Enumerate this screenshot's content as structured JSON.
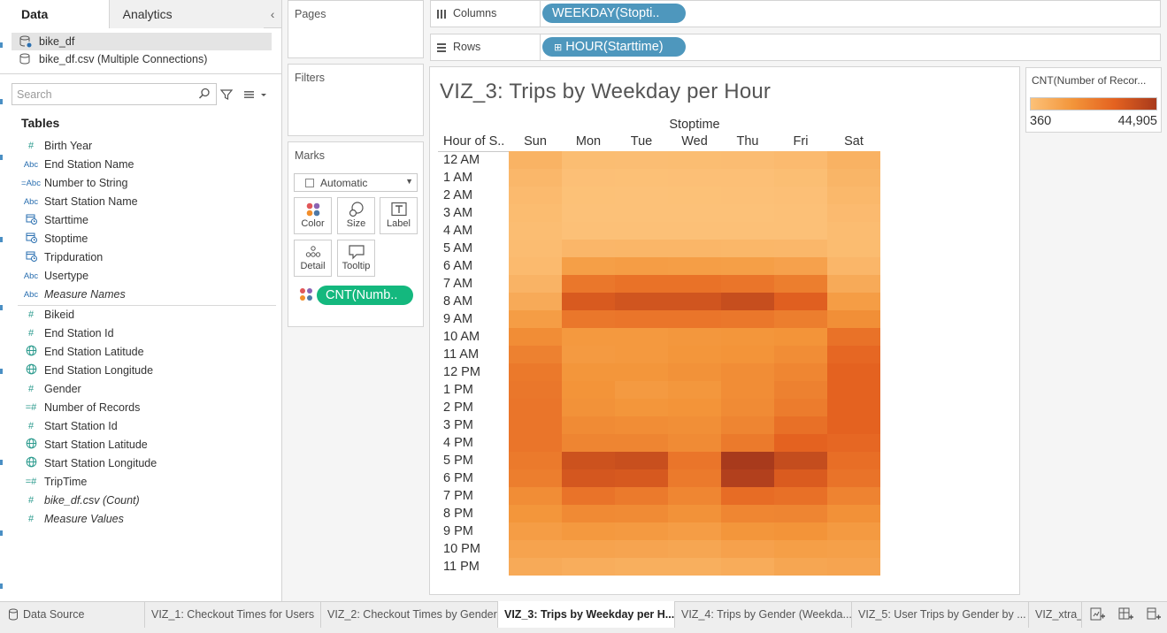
{
  "left_pane": {
    "tab_data": "Data",
    "tab_analytics": "Analytics",
    "collapse_glyph": "‹",
    "sources": [
      "bike_df",
      "bike_df.csv (Multiple Connections)"
    ],
    "search_placeholder": "Search",
    "tables_header": "Tables",
    "dimensions": [
      {
        "icon": "#",
        "name": "Birth Year",
        "italic": false
      },
      {
        "icon": "Abc",
        "name": "End Station Name",
        "italic": false
      },
      {
        "icon": "=Abc",
        "name": "Number to String",
        "italic": false
      },
      {
        "icon": "Abc",
        "name": "Start Station Name",
        "italic": false
      },
      {
        "icon": "calendar",
        "name": "Starttime",
        "italic": false
      },
      {
        "icon": "calendar",
        "name": "Stoptime",
        "italic": false
      },
      {
        "icon": "calendar",
        "name": "Tripduration",
        "italic": false
      },
      {
        "icon": "Abc",
        "name": "Usertype",
        "italic": false
      },
      {
        "icon": "Abc",
        "name": "Measure Names",
        "italic": true
      }
    ],
    "measures": [
      {
        "icon": "#",
        "name": "Bikeid",
        "italic": false
      },
      {
        "icon": "#",
        "name": "End Station Id",
        "italic": false
      },
      {
        "icon": "globe",
        "name": "End Station Latitude",
        "italic": false
      },
      {
        "icon": "globe",
        "name": "End Station Longitude",
        "italic": false
      },
      {
        "icon": "#",
        "name": "Gender",
        "italic": false
      },
      {
        "icon": "=#",
        "name": "Number of Records",
        "italic": false
      },
      {
        "icon": "#",
        "name": "Start Station Id",
        "italic": false
      },
      {
        "icon": "globe",
        "name": "Start Station Latitude",
        "italic": false
      },
      {
        "icon": "globe",
        "name": "Start Station Longitude",
        "italic": false
      },
      {
        "icon": "=#",
        "name": "TripTime",
        "italic": false
      },
      {
        "icon": "#",
        "name": "bike_df.csv (Count)",
        "italic": true
      },
      {
        "icon": "#",
        "name": "Measure Values",
        "italic": true
      }
    ]
  },
  "shelves": {
    "pages": "Pages",
    "filters": "Filters",
    "marks": "Marks",
    "mark_type": "Automatic",
    "mark_buttons": [
      "Color",
      "Size",
      "Label",
      "Detail",
      "Tooltip"
    ],
    "color_pill": "CNT(Numb..",
    "columns_label": "Columns",
    "columns_pill": "WEEKDAY(Stopti..",
    "rows_label": "Rows",
    "rows_pill": "HOUR(Starttime)",
    "rows_pill_glyph": "⊞"
  },
  "viz": {
    "title": "VIZ_3: Trips by Weekday per Hour",
    "column_field_title": "Stoptime",
    "row_header_title": "Hour of S..",
    "legend_title": "CNT(Number of Recor...",
    "legend_min": "360",
    "legend_max": "44,905"
  },
  "chart_data": {
    "type": "heatmap",
    "title": "VIZ_3: Trips by Weekday per Hour",
    "xlabel": "Stoptime",
    "ylabel": "Hour of S..",
    "x": [
      "Sun",
      "Mon",
      "Tue",
      "Wed",
      "Thu",
      "Fri",
      "Sat"
    ],
    "y": [
      "12 AM",
      "1 AM",
      "2 AM",
      "3 AM",
      "4 AM",
      "5 AM",
      "6 AM",
      "7 AM",
      "8 AM",
      "9 AM",
      "10 AM",
      "11 AM",
      "12 PM",
      "1 PM",
      "2 PM",
      "3 PM",
      "4 PM",
      "5 PM",
      "6 PM",
      "7 PM",
      "8 PM",
      "9 PM",
      "10 PM",
      "11 PM"
    ],
    "values": [
      [
        5200,
        1800,
        1600,
        1800,
        1900,
        2600,
        5500
      ],
      [
        3800,
        900,
        800,
        900,
        950,
        1500,
        4500
      ],
      [
        2800,
        500,
        450,
        500,
        550,
        900,
        3500
      ],
      [
        2200,
        400,
        360,
        400,
        420,
        600,
        2600
      ],
      [
        1800,
        600,
        550,
        600,
        600,
        700,
        2000
      ],
      [
        2000,
        4000,
        4200,
        4100,
        3900,
        3600,
        2200
      ],
      [
        2800,
        12000,
        12500,
        12300,
        12000,
        11000,
        4000
      ],
      [
        5000,
        24000,
        25500,
        25500,
        24500,
        22000,
        8000
      ],
      [
        8000,
        33000,
        35000,
        35000,
        37500,
        31000,
        12500
      ],
      [
        12500,
        24000,
        24500,
        24500,
        24000,
        22000,
        17000
      ],
      [
        17500,
        14000,
        14000,
        14500,
        15000,
        15500,
        25500
      ],
      [
        21000,
        13500,
        14000,
        15000,
        15500,
        17500,
        28500
      ],
      [
        23500,
        15000,
        15000,
        16000,
        17500,
        19500,
        30000
      ],
      [
        24000,
        15500,
        13500,
        14500,
        17500,
        21000,
        30000
      ],
      [
        24500,
        16000,
        15000,
        15500,
        18000,
        22500,
        30000
      ],
      [
        24500,
        18000,
        17500,
        17000,
        20000,
        26000,
        30000
      ],
      [
        24500,
        20000,
        20000,
        18000,
        23000,
        30000,
        28500
      ],
      [
        23000,
        36000,
        37000,
        24500,
        44905,
        38000,
        26500
      ],
      [
        22000,
        34000,
        33500,
        23000,
        42500,
        32500,
        25000
      ],
      [
        17500,
        25000,
        23000,
        19500,
        27000,
        26000,
        20500
      ],
      [
        15000,
        18500,
        18000,
        16000,
        19500,
        20000,
        16500
      ],
      [
        12500,
        14000,
        13500,
        12500,
        15000,
        15500,
        13500
      ],
      [
        10500,
        10500,
        10000,
        9500,
        11000,
        12000,
        11500
      ],
      [
        8000,
        7000,
        6500,
        6500,
        7500,
        9500,
        10000
      ]
    ],
    "color_min": 360,
    "color_max": 44905,
    "colors": [
      "#fcc178",
      "#f3953a",
      "#e46220",
      "#a83a1c"
    ],
    "legend_title": "CNT(Number of Recor..."
  },
  "bottom_tabs": {
    "data_source": "Data Source",
    "sheets": [
      "VIZ_1: Checkout Times for Users",
      "VIZ_2: Checkout Times by Gender",
      "VIZ_3: Trips by Weekday per H...",
      "VIZ_4: Trips by Gender (Weekda...",
      "VIZ_5: User Trips by Gender by ...",
      "VIZ_xtra_"
    ],
    "active_sheet_index": 2
  }
}
